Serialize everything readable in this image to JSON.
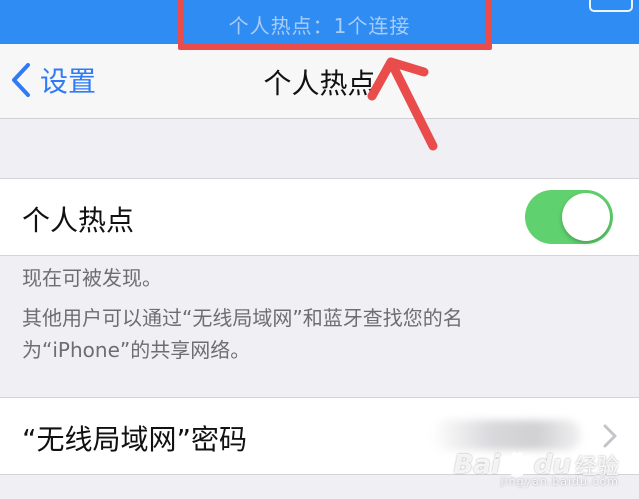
{
  "status_bar": {
    "hotspot_indicator": "个人热点：1个连接",
    "background_color": "#2f8cf2"
  },
  "nav": {
    "back_label": "设置",
    "title": "个人热点"
  },
  "hotspot_cell": {
    "label": "个人热点",
    "toggle_on": true,
    "toggle_color": "#5fd16e"
  },
  "info": {
    "line1": "现在可被发现。",
    "line2": "其他用户可以通过“无线局域网”和蓝牙查找您的名",
    "line3": "为“iPhone”的共享网络。"
  },
  "password_cell": {
    "label": "“无线局域网”密码"
  },
  "annotation": {
    "color": "#ea4c4c"
  },
  "watermark": {
    "logo_text": "Bai",
    "logo_text_2": "du",
    "brand": "经验",
    "sub": "jingyan.baidu.com"
  }
}
